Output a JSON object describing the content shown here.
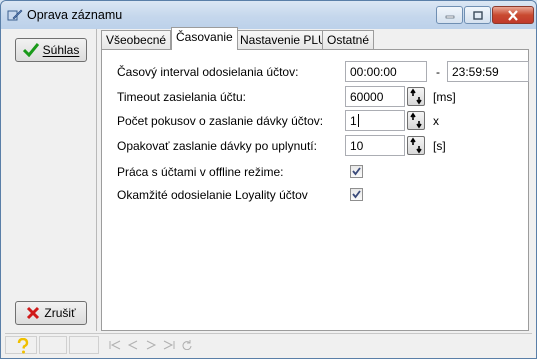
{
  "window": {
    "title": "Oprava záznamu"
  },
  "buttons": {
    "ok_label": "Súhlas",
    "cancel_label": "Zrušiť"
  },
  "tabs": [
    {
      "label": "Všeobecné",
      "active": false
    },
    {
      "label": "Časovanie",
      "active": true
    },
    {
      "label": "Nastavenie PLU",
      "active": false
    },
    {
      "label": "Ostatné",
      "active": false
    }
  ],
  "form": {
    "interval_label": "Časový interval odosielania účtov:",
    "interval_from": "00:00:00",
    "interval_sep": "-",
    "interval_to": "23:59:59",
    "timeout_label": "Timeout zasielania účtu:",
    "timeout_value": "60000",
    "timeout_unit": "[ms]",
    "attempts_label": "Počet pokusov o zaslanie dávky účtov:",
    "attempts_value": "1",
    "attempts_unit": "x",
    "retry_label": "Opakovať zaslanie dávky po uplynutí:",
    "retry_value": "10",
    "retry_unit": "[s]",
    "offline_label": "Práca s účtami v offline režime:",
    "offline_checked": true,
    "loyalty_label": "Okamžité odosielanie Loyality účtov",
    "loyalty_checked": true
  },
  "statusbar": {
    "help_icon": "help-question-icon",
    "nav_icons": [
      "first-record-icon",
      "prev-record-icon",
      "next-record-icon",
      "last-record-icon",
      "refresh-icon"
    ]
  },
  "colors": {
    "ok_check": "#1a9a1a",
    "cancel_x": "#d01a1a",
    "help": "#f0c000"
  }
}
